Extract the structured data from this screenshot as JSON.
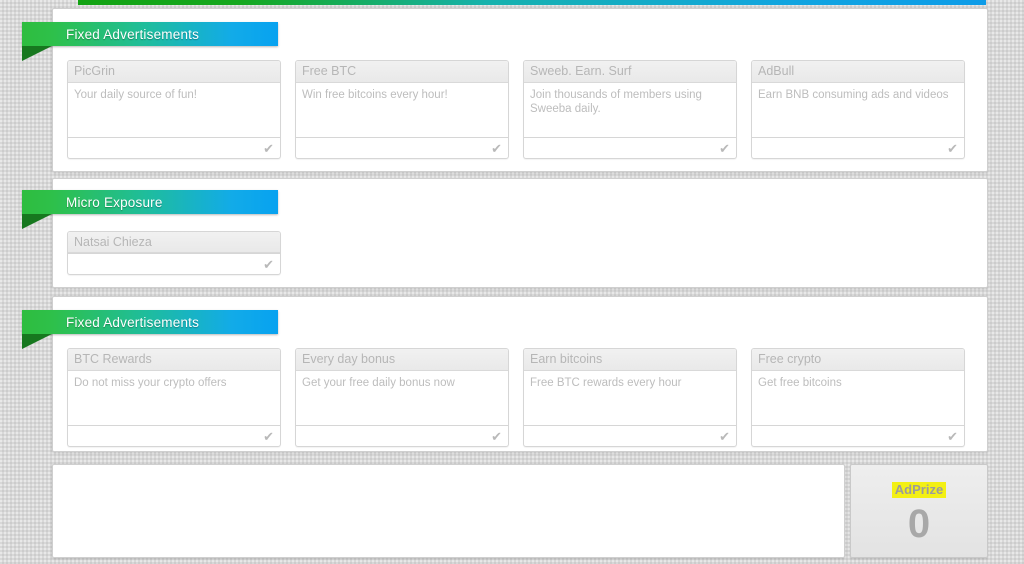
{
  "top_bar": {
    "gradient_from": "#13a313",
    "gradient_to": "#0d9ce8"
  },
  "sections": [
    {
      "ribbon_label": "Fixed Advertisements",
      "cards": [
        {
          "title": "PicGrin",
          "description": "Your daily source of fun!",
          "check": "✔"
        },
        {
          "title": "Free BTC",
          "description": "Win free bitcoins every hour!",
          "check": "✔"
        },
        {
          "title": "Sweeb. Earn. Surf",
          "description": "Join thousands of members using Sweeba daily.",
          "check": "✔"
        },
        {
          "title": "AdBull",
          "description": "Earn BNB consuming ads and videos",
          "check": "✔"
        }
      ]
    },
    {
      "ribbon_label": "Micro Exposure",
      "cards": [
        {
          "title": "Natsai Chieza",
          "description": "",
          "check": "✔"
        }
      ]
    },
    {
      "ribbon_label": "Fixed Advertisements",
      "cards": [
        {
          "title": "BTC Rewards",
          "description": "Do not miss your crypto offers",
          "check": "✔"
        },
        {
          "title": "Every day bonus",
          "description": "Get your free daily bonus now",
          "check": "✔"
        },
        {
          "title": "Earn bitcoins",
          "description": "Free BTC rewards every hour",
          "check": "✔"
        },
        {
          "title": "Free crypto",
          "description": "Get free bitcoins",
          "check": "✔"
        }
      ]
    }
  ],
  "adprize": {
    "title": "AdPrize",
    "count": "0",
    "highlight_color": "#f3f014",
    "text_color": "#9c9c9c"
  }
}
